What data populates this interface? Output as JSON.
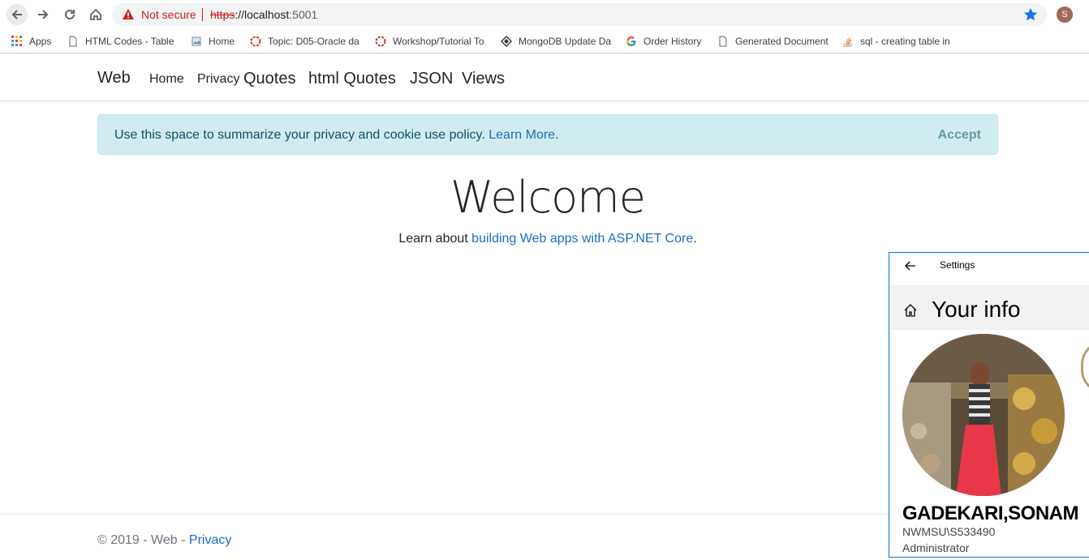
{
  "browser": {
    "security_label": "Not secure",
    "url_scheme": "https",
    "url_rest": "://localhost",
    "url_port": ":5001",
    "profile_initial": "S"
  },
  "bookmarks": [
    {
      "label": "Apps",
      "icon": "apps-grid-icon"
    },
    {
      "label": "HTML Codes - Table c",
      "icon": "page-icon"
    },
    {
      "label": "Home",
      "icon": "page-image-icon"
    },
    {
      "label": "Topic: D05-Oracle da",
      "icon": "oracle-ring-icon"
    },
    {
      "label": "Workshop/Tutorial To",
      "icon": "oracle-ring-icon"
    },
    {
      "label": "MongoDB Update Da",
      "icon": "diamond-icon"
    },
    {
      "label": "Order History",
      "icon": "google-g-icon"
    },
    {
      "label": "Generated Document",
      "icon": "page-icon"
    },
    {
      "label": "sql - creating table in",
      "icon": "stackoverflow-icon"
    }
  ],
  "site_nav": {
    "brand": "Web",
    "links": [
      "Home",
      "Privacy",
      "Quotes",
      "html Quotes",
      "JSON",
      "Views"
    ]
  },
  "cookie": {
    "text": "Use this space to summarize your privacy and cookie use policy.",
    "link": "Learn More",
    "period": ".",
    "accept": "Accept"
  },
  "main": {
    "heading": "Welcome",
    "learn_prefix": "Learn about",
    "learn_link": "building Web apps with ASP.NET Core",
    "learn_suffix": "."
  },
  "footer": {
    "text": "© 2019 - Web -",
    "link": "Privacy"
  },
  "settings": {
    "window_title": "Settings",
    "heading": "Your info",
    "name": "GADEKARI,SONAM",
    "account": "NWMSU\\S533490",
    "role": "Administrator"
  },
  "colors": {
    "link": "#1b6ec2",
    "alert_bg": "#d1ecf1",
    "alert_text": "#0c5460",
    "warning": "#c5221f",
    "accent": "#0078d7"
  }
}
